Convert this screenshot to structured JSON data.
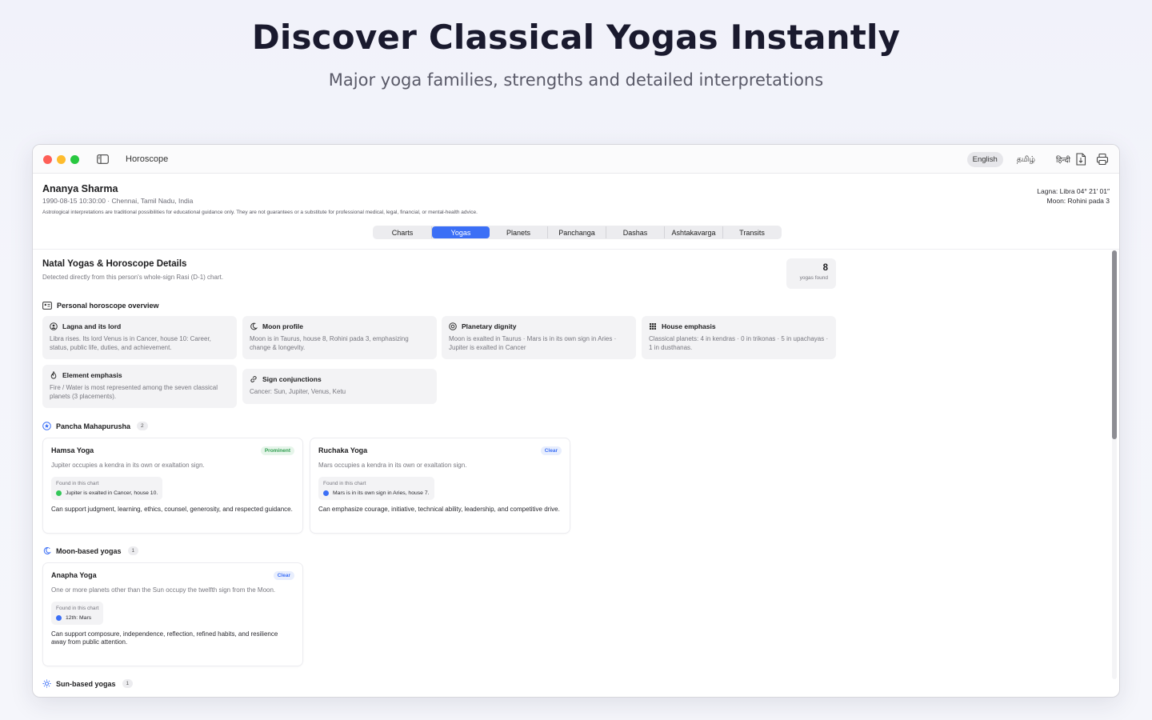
{
  "hero": {
    "title": "Discover Classical Yogas Instantly",
    "subtitle": "Major yoga families, strengths and detailed interpretations"
  },
  "window": {
    "title": "Horoscope",
    "languages": [
      "English",
      "தமிழ்",
      "हिन्दी"
    ],
    "active_language": "English"
  },
  "profile": {
    "name": "Ananya Sharma",
    "meta": "1990-08-15  10:30:00  ·  Chennai, Tamil Nadu, India",
    "disclaimer": "Astrological interpretations are traditional possibilities for educational guidance only. They are not guarantees or a substitute for professional medical, legal, financial, or mental-health advice.",
    "lagna": "Lagna: Libra 04° 21′ 01″",
    "moon": "Moon: Rohini pada 3"
  },
  "tabs": [
    "Charts",
    "Yogas",
    "Planets",
    "Panchanga",
    "Dashas",
    "Ashtakavarga",
    "Transits"
  ],
  "active_tab": "Yogas",
  "section": {
    "title": "Natal Yogas & Horoscope Details",
    "subtitle": "Detected directly from this person's whole-sign Rasi (D-1) chart.",
    "found_count": "8",
    "found_label": "yogas found"
  },
  "overview": {
    "heading": "Personal horoscope overview",
    "cards": [
      {
        "title": "Lagna and its lord",
        "icon": "person-circle-icon",
        "text": "Libra rises. Its lord Venus is in Cancer, house 10: Career, status, public life, duties, and achievement."
      },
      {
        "title": "Moon profile",
        "icon": "moon-icon",
        "text": "Moon is in Taurus, house 8, Rohini pada 3, emphasizing change & longevity."
      },
      {
        "title": "Planetary dignity",
        "icon": "dignity-icon",
        "text": "Moon is exalted in Taurus · Mars is in its own sign in Aries · Jupiter is exalted in Cancer"
      },
      {
        "title": "House emphasis",
        "icon": "grid-icon",
        "text": "Classical planets: 4 in kendras · 0 in trikonas · 5 in upachayas · 1 in dusthanas."
      },
      {
        "title": "Element emphasis",
        "icon": "flame-icon",
        "text": "Fire / Water is most represented among the seven classical planets (3 placements)."
      },
      {
        "title": "Sign conjunctions",
        "icon": "link-icon",
        "text": "Cancer: Sun, Jupiter, Venus, Ketu"
      }
    ]
  },
  "groups": {
    "pancha": {
      "title": "Pancha Mahapurusha",
      "count": "2"
    },
    "moon": {
      "title": "Moon-based yogas",
      "count": "1"
    },
    "sun": {
      "title": "Sun-based yogas",
      "count": "1"
    }
  },
  "yogas": {
    "hamsa": {
      "name": "Hamsa Yoga",
      "tag": "Prominent",
      "desc": "Jupiter occupies a kendra in its own or exaltation sign.",
      "found_label": "Found in this chart",
      "found_item": "Jupiter is exalted in Cancer, house 10.",
      "effect": "Can support judgment, learning, ethics, counsel, generosity, and respected guidance."
    },
    "ruchaka": {
      "name": "Ruchaka Yoga",
      "tag": "Clear",
      "desc": "Mars occupies a kendra in its own or exaltation sign.",
      "found_label": "Found in this chart",
      "found_item": "Mars is in its own sign in Aries, house 7.",
      "effect": "Can emphasize courage, initiative, technical ability, leadership, and competitive drive."
    },
    "anapha": {
      "name": "Anapha Yoga",
      "tag": "Clear",
      "desc": "One or more planets other than the Sun occupy the twelfth sign from the Moon.",
      "found_label": "Found in this chart",
      "found_item": "12th: Mars",
      "effect": "Can support composure, independence, reflection, refined habits, and resilience away from public attention."
    }
  },
  "colors": {
    "accent": "#3b6ff6",
    "prominent": "#2f9e4f",
    "hero_title": "#1a1a2e"
  }
}
